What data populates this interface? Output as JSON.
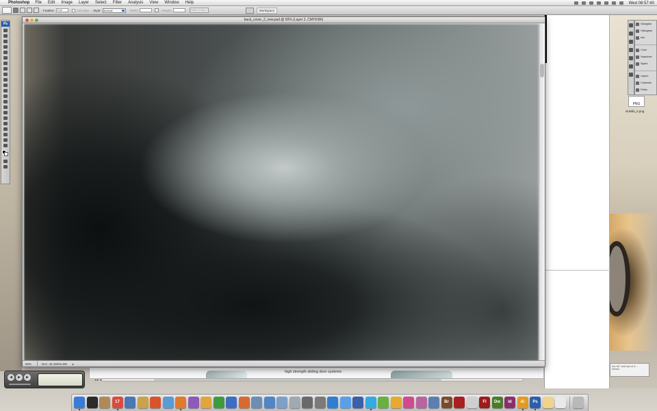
{
  "menubar": {
    "app_name": "Photoshop",
    "items": [
      "File",
      "Edit",
      "Image",
      "Layer",
      "Select",
      "Filter",
      "Analysis",
      "View",
      "Window",
      "Help"
    ],
    "clock": "Wed 08:57:40"
  },
  "options_bar": {
    "feather_label": "Feather:",
    "feather_value": "0 px",
    "antialias_label": "Anti-alias",
    "style_label": "Style:",
    "style_value": "Normal",
    "width_label": "Width:",
    "height_label": "Height:",
    "refine_label": "Refine Edge...",
    "workspace_label": "Workspace"
  },
  "toolbox": {
    "logo": "Ps"
  },
  "document": {
    "title": "back_cover_2_new.psd @ 50% (Layer 2, CMYK/8#)",
    "zoom": "50%",
    "doc_info": "Doc: 40.1M/31.6M"
  },
  "under_page": {
    "caption": "high strength sliding door systems"
  },
  "panels": {
    "items": [
      "Navigator",
      "Histogram",
      "Info",
      "Color",
      "Swatches",
      "Styles",
      "Layers",
      "Channels",
      "Paths"
    ]
  },
  "desktop_file": {
    "thumb_text": "PNG",
    "name": "vlokilla_0.png"
  },
  "notification": {
    "line1": "kin: 64\" and hyn st 4...",
    "line2": "Wheel"
  },
  "media_widget": {
    "prev": "◀",
    "play": "▶",
    "next": "▶",
    "logo": ""
  },
  "dock": {
    "icons": [
      {
        "name": "finder",
        "label": "",
        "color": "#3a7bd5"
      },
      {
        "name": "dashboard",
        "label": "",
        "color": "#2b2b2b"
      },
      {
        "name": "notebook",
        "label": "",
        "color": "#b08a55"
      },
      {
        "name": "ical",
        "label": "17",
        "color": "#d94b3d"
      },
      {
        "name": "xcode",
        "label": "",
        "color": "#4a77b5"
      },
      {
        "name": "cyberduck",
        "label": "",
        "color": "#c9a24a"
      },
      {
        "name": "office",
        "label": "",
        "color": "#d9532c"
      },
      {
        "name": "safari",
        "label": "",
        "color": "#5b9bd5"
      },
      {
        "name": "firefox",
        "label": "",
        "color": "#e07b2a"
      },
      {
        "name": "messenger",
        "label": "",
        "color": "#8d5ab8"
      },
      {
        "name": "pages",
        "label": "",
        "color": "#e3a43c"
      },
      {
        "name": "excel",
        "label": "",
        "color": "#3f9a3f"
      },
      {
        "name": "word",
        "label": "",
        "color": "#3d6dc2"
      },
      {
        "name": "powerpoint",
        "label": "",
        "color": "#d86a2f"
      },
      {
        "name": "network",
        "label": "",
        "color": "#6d8db3"
      },
      {
        "name": "backup",
        "label": "",
        "color": "#4e86c7"
      },
      {
        "name": "iphoto",
        "label": "",
        "color": "#7f9fc9"
      },
      {
        "name": "preview",
        "label": "",
        "color": "#a0a8b0"
      },
      {
        "name": "bittorrent",
        "label": "",
        "color": "#6a6a6a"
      },
      {
        "name": "printer",
        "label": "",
        "color": "#7a7a7a"
      },
      {
        "name": "quicktime",
        "label": "",
        "color": "#2f7fd1"
      },
      {
        "name": "itunes",
        "label": "",
        "color": "#5aa0e6"
      },
      {
        "name": "star",
        "label": "",
        "color": "#3b5fa8"
      },
      {
        "name": "skype",
        "label": "",
        "color": "#35a9e2"
      },
      {
        "name": "leaf",
        "label": "",
        "color": "#69b043"
      },
      {
        "name": "flower",
        "label": "",
        "color": "#e7a92e"
      },
      {
        "name": "adium",
        "label": "",
        "color": "#d24a8c"
      },
      {
        "name": "colorsync",
        "label": "",
        "color": "#b8659d"
      },
      {
        "name": "folder",
        "label": "",
        "color": "#5a7fb0"
      },
      {
        "name": "bridge",
        "label": "Br",
        "color": "#7a4c2a"
      },
      {
        "name": "acrobat",
        "label": "",
        "color": "#a82020"
      },
      {
        "name": "pdf",
        "label": "",
        "color": "#cfcfcf"
      },
      {
        "name": "flash",
        "label": "Fl",
        "color": "#9e1b1b"
      },
      {
        "name": "dreamweaver",
        "label": "Dw",
        "color": "#4a7c2a"
      },
      {
        "name": "indesign",
        "label": "Id",
        "color": "#8a2f6d"
      },
      {
        "name": "illustrator",
        "label": "Ai",
        "color": "#e39a1f"
      },
      {
        "name": "photoshop",
        "label": "Ps",
        "color": "#2b5fae"
      },
      {
        "name": "sun",
        "label": "",
        "color": "#f0d48a"
      },
      {
        "name": "document",
        "label": "",
        "color": "#e9e9e9"
      },
      {
        "name": "trash",
        "label": "",
        "color": "#b9b9b9"
      }
    ]
  },
  "colors": {
    "menubar": "#e6e6e6",
    "photoshop_blue": "#2d5ca6",
    "canvas_dark": "#101414",
    "canvas_light": "#c3c9c9"
  }
}
